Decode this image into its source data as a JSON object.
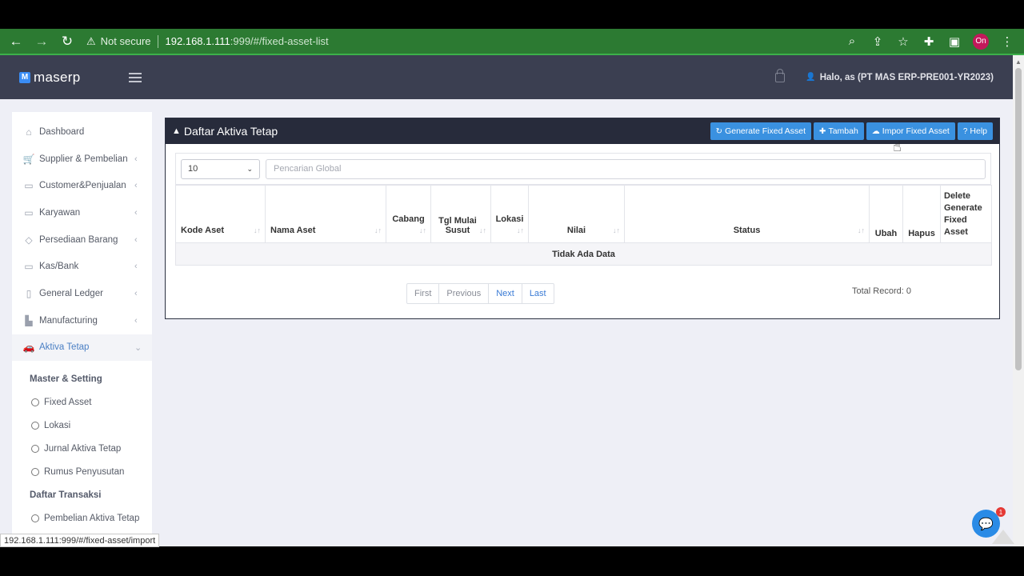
{
  "browser": {
    "not_secure": "Not secure",
    "url_host": "192.168.1.111",
    "url_path": ":999/#/fixed-asset-list",
    "profile": "On"
  },
  "app": {
    "logo": "maserp",
    "logo_mark": "M",
    "greeting": "Halo, as (PT MAS ERP-PRE001-YR2023)"
  },
  "sidebar": {
    "items": [
      {
        "label": "Dashboard",
        "icon": "home-icon",
        "glyph": "⌂",
        "chevron": ""
      },
      {
        "label": "Supplier & Pembelian",
        "icon": "cart-icon",
        "glyph": "🛒",
        "chevron": "‹"
      },
      {
        "label": "Customer&Penjualan",
        "icon": "store-icon",
        "glyph": "▭",
        "chevron": "‹"
      },
      {
        "label": "Karyawan",
        "icon": "card-icon",
        "glyph": "▭",
        "chevron": "‹"
      },
      {
        "label": "Persediaan Barang",
        "icon": "tag-icon",
        "glyph": "◇",
        "chevron": "‹"
      },
      {
        "label": "Kas/Bank",
        "icon": "money-icon",
        "glyph": "▭",
        "chevron": "‹"
      },
      {
        "label": "General Ledger",
        "icon": "book-icon",
        "glyph": "▯",
        "chevron": "‹"
      },
      {
        "label": "Manufacturing",
        "icon": "factory-icon",
        "glyph": "▙",
        "chevron": "‹"
      },
      {
        "label": "Aktiva Tetap",
        "icon": "car-icon",
        "glyph": "🚗",
        "chevron": "⌄"
      }
    ],
    "section_master": "Master & Setting",
    "master_items": [
      "Fixed Asset",
      "Lokasi",
      "Jurnal Aktiva Tetap",
      "Rumus Penyusutan"
    ],
    "section_transaksi": "Daftar Transaksi",
    "transaksi_items": [
      "Pembelian Aktiva Tetap"
    ]
  },
  "panel": {
    "title": "Daftar Aktiva Tetap",
    "buttons": {
      "generate": "Generate Fixed Asset",
      "tambah": "Tambah",
      "impor": "Impor Fixed Asset",
      "help": "Help"
    },
    "page_size": "10",
    "search_placeholder": "Pencarian Global",
    "columns": {
      "kode": "Kode Aset",
      "nama": "Nama Aset",
      "cabang": "Cabang",
      "tgl": "Tgl Mulai Susut",
      "lokasi": "Lokasi",
      "nilai": "Nilai",
      "status": "Status",
      "ubah": "Ubah",
      "hapus": "Hapus",
      "delete_gen": "Delete Generate Fixed Asset"
    },
    "empty_text": "Tidak Ada Data",
    "pager": {
      "first": "First",
      "previous": "Previous",
      "next": "Next",
      "last": "Last"
    },
    "total": "Total Record: 0"
  },
  "status_bar": "192.168.1.111:999/#/fixed-asset/import",
  "chat_badge": "1"
}
